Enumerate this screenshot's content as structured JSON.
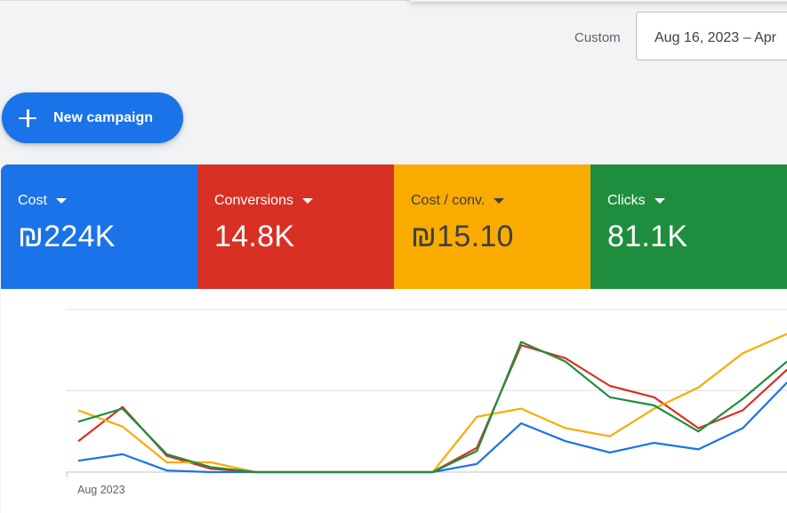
{
  "toolbar": {
    "date_label": "Custom",
    "date_range": "Aug 16, 2023 – Apr"
  },
  "actions": {
    "new_campaign_label": "New campaign",
    "new_campaign_icon": "plus-icon"
  },
  "scorecards": [
    {
      "label": "Cost",
      "value": "₪224K",
      "color": "#1a73e8"
    },
    {
      "label": "Conversions",
      "value": "14.8K",
      "color": "#d93025"
    },
    {
      "label": "Cost / conv.",
      "value": "₪15.10",
      "color": "#f9ab00"
    },
    {
      "label": "Clicks",
      "value": "81.1K",
      "color": "#1e8e3e"
    }
  ],
  "chart_data": {
    "type": "line",
    "x_tick_labels": [
      "Aug 2023"
    ],
    "x": [
      0,
      1,
      2,
      3,
      4,
      5,
      6,
      7,
      8,
      9,
      10,
      11,
      12,
      13,
      14,
      15,
      16
    ],
    "ylim": [
      0,
      1
    ],
    "grid": true,
    "series": [
      {
        "color": "#1a73e8",
        "values": [
          0.07,
          0.11,
          0.01,
          0.0,
          0.0,
          0.0,
          0.0,
          0.0,
          0.0,
          0.05,
          0.3,
          0.19,
          0.12,
          0.18,
          0.14,
          0.27,
          0.55
        ]
      },
      {
        "color": "#d93025",
        "values": [
          0.19,
          0.4,
          0.1,
          0.02,
          0.0,
          0.0,
          0.0,
          0.0,
          0.0,
          0.15,
          0.78,
          0.7,
          0.53,
          0.46,
          0.27,
          0.38,
          0.63
        ]
      },
      {
        "color": "#f9ab00",
        "values": [
          0.38,
          0.28,
          0.06,
          0.06,
          0.0,
          0.0,
          0.0,
          0.0,
          0.0,
          0.34,
          0.39,
          0.27,
          0.22,
          0.39,
          0.52,
          0.73,
          0.85
        ]
      },
      {
        "color": "#1e8e3e",
        "values": [
          0.31,
          0.39,
          0.11,
          0.03,
          0.0,
          0.0,
          0.0,
          0.0,
          0.0,
          0.13,
          0.8,
          0.68,
          0.46,
          0.41,
          0.25,
          0.45,
          0.68
        ]
      }
    ]
  }
}
